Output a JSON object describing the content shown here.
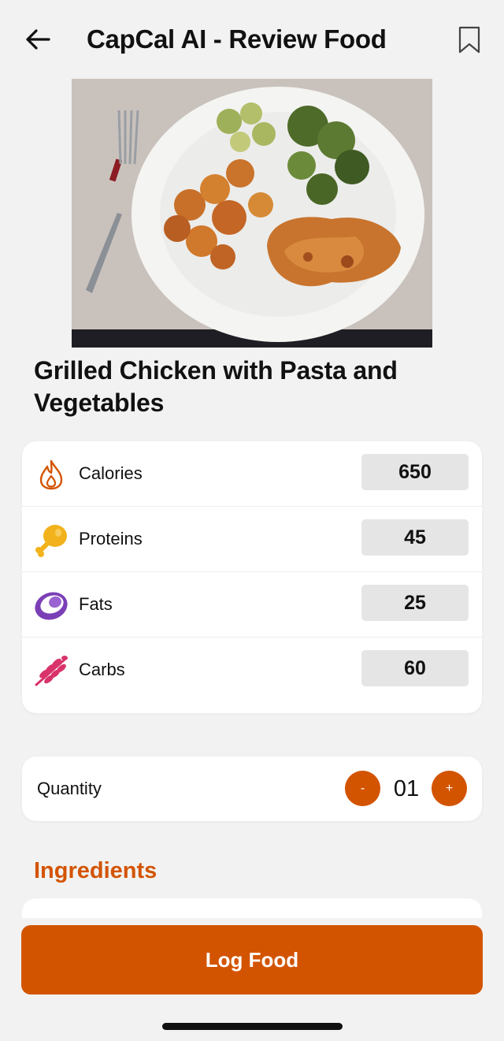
{
  "header": {
    "title": "CapCal AI - Review Food",
    "back_icon": "arrow-left-icon",
    "bookmark_icon": "bookmark-icon"
  },
  "food": {
    "image_icon": "food-photo",
    "name": "Grilled Chicken with Pasta and Vegetables"
  },
  "nutrition": [
    {
      "label": "Calories",
      "value": "650",
      "icon": "flame-icon",
      "color": "#d35400"
    },
    {
      "label": "Proteins",
      "value": "45",
      "icon": "drumstick-icon",
      "color": "#f2b21b"
    },
    {
      "label": "Fats",
      "value": "25",
      "icon": "avocado-icon",
      "color": "#7b3fb6"
    },
    {
      "label": "Carbs",
      "value": "60",
      "icon": "wheat-icon",
      "color": "#d8336b"
    }
  ],
  "quantity": {
    "label": "Quantity",
    "value": "01",
    "minus_label": "-",
    "plus_label": "+"
  },
  "ingredients": {
    "title": "Ingredients"
  },
  "actions": {
    "log_label": "Log Food"
  },
  "colors": {
    "accent": "#d35400",
    "background": "#f2f2f2",
    "card": "#ffffff",
    "value_box": "#e5e5e5"
  }
}
